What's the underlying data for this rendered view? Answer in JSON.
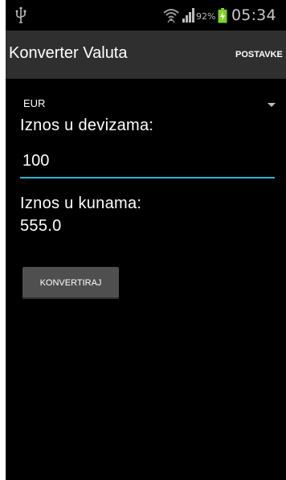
{
  "status_bar": {
    "battery_percent": "92%",
    "time": "05:34",
    "icons": [
      "usb-icon",
      "wifi-icon",
      "signal-icon",
      "battery-charging-icon"
    ]
  },
  "action_bar": {
    "title": "Konverter Valuta",
    "settings_label": "POSTAVKE"
  },
  "form": {
    "currency_selected": "EUR",
    "foreign_label": "Iznos u devizama:",
    "amount_value": "100",
    "kuna_label": "Iznos u kunama:",
    "result_value": "555.0",
    "convert_label": "KONVERTIRAJ"
  },
  "colors": {
    "input_underline": "#2bb7d5",
    "battery_charging": "#7ed321",
    "action_bar_bg": "#2f2f2f"
  }
}
